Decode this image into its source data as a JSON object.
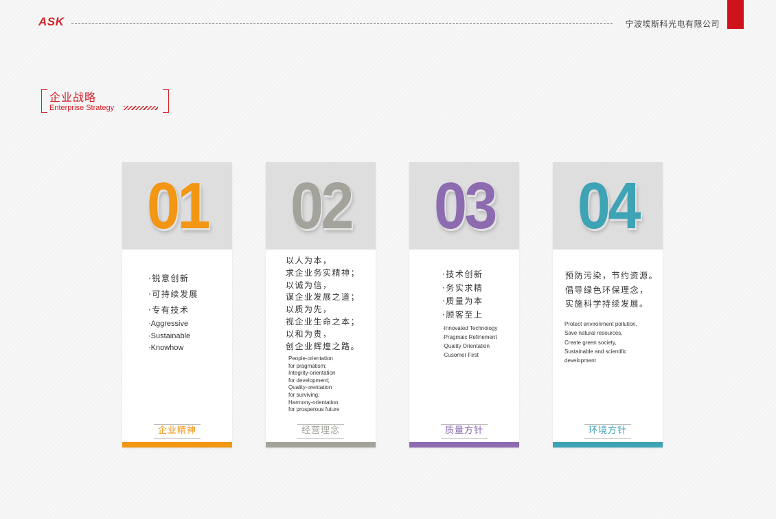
{
  "header": {
    "logo": "ASK",
    "company": "宁波埃斯科光电有限公司",
    "accent_color": "#d61f26"
  },
  "section": {
    "title_zh": "企业战略",
    "title_en": "Enterprise Strategy"
  },
  "cards": [
    {
      "number": "01",
      "color": "#f29614",
      "zh_lines": [
        "·锐意创新",
        "·可持续发展",
        "·专有技术"
      ],
      "en_lines": [
        "·Aggressive",
        "·Sustainable",
        "·Knowhow"
      ],
      "label": "企业精神"
    },
    {
      "number": "02",
      "color": "#a3a39b",
      "zh_lines": [
        "以人为本，",
        "求企业务实精神；",
        "以诚为信，",
        "谋企业发展之道；",
        "以质为先，",
        "视企业生命之本；",
        "以和为贵，",
        "创企业辉煌之路。"
      ],
      "en_lines": [
        "People-orientation",
        "for pragmatism;",
        "Integrity-orientation",
        "for development;",
        "Quality-orentation",
        "for surviving;",
        "Harmony-orientation",
        "for prosperous future"
      ],
      "label": "经营理念"
    },
    {
      "number": "03",
      "color": "#8c6bb1",
      "zh_lines": [
        "·技术创新",
        "·务实求精",
        "·质量为本",
        "·顾客至上"
      ],
      "en_lines": [
        "·Innovated Technology",
        "·Pragmaic Refinement",
        "·Quality Orientation",
        "·Cusomer First"
      ],
      "label": "质量方针"
    },
    {
      "number": "04",
      "color": "#3ea3b4",
      "zh_lines": [
        "预防污染，节约资源。",
        "倡导绿色环保理念，",
        "实施科学持续发展。"
      ],
      "en_lines": [
        "Protect environment pollution,",
        "Save natural resources,",
        "Create green society,",
        "Sustainable and scientific",
        "development"
      ],
      "label": "环境方针"
    }
  ]
}
